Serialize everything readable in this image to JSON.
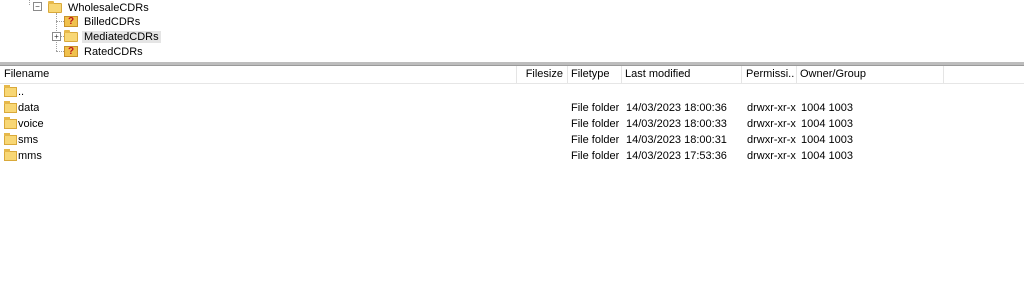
{
  "tree": {
    "parent": "WholesaleCDRs",
    "children": [
      {
        "label": "BilledCDRs",
        "icon": "unknown-folder-icon",
        "expander": false
      },
      {
        "label": "MediatedCDRs",
        "icon": "folder-icon",
        "expander": true
      },
      {
        "label": "RatedCDRs",
        "icon": "unknown-folder-icon",
        "expander": false
      }
    ],
    "collapse_symbol": "−",
    "expand_symbol": "+",
    "unknown_mark": "?"
  },
  "columns": {
    "filename": "Filename",
    "filesize": "Filesize",
    "filetype": "Filetype",
    "last_modified": "Last modified",
    "permissions": "Permissi...",
    "owner_group": "Owner/Group"
  },
  "files": [
    {
      "name": "..",
      "size": "",
      "type": "",
      "modified": "",
      "perms": "",
      "owner": ""
    },
    {
      "name": "data",
      "size": "",
      "type": "File folder",
      "modified": "14/03/2023 18:00:36",
      "perms": "drwxr-xr-x",
      "owner": "1004 1003"
    },
    {
      "name": "voice",
      "size": "",
      "type": "File folder",
      "modified": "14/03/2023 18:00:33",
      "perms": "drwxr-xr-x",
      "owner": "1004 1003"
    },
    {
      "name": "sms",
      "size": "",
      "type": "File folder",
      "modified": "14/03/2023 18:00:31",
      "perms": "drwxr-xr-x",
      "owner": "1004 1003"
    },
    {
      "name": "mms",
      "size": "",
      "type": "File folder",
      "modified": "14/03/2023 17:53:36",
      "perms": "drwxr-xr-x",
      "owner": "1004 1003"
    }
  ],
  "colors": {
    "folder": "#f8d775",
    "selection": "#e5e5e5",
    "unknown_mark": "#c0141b"
  }
}
